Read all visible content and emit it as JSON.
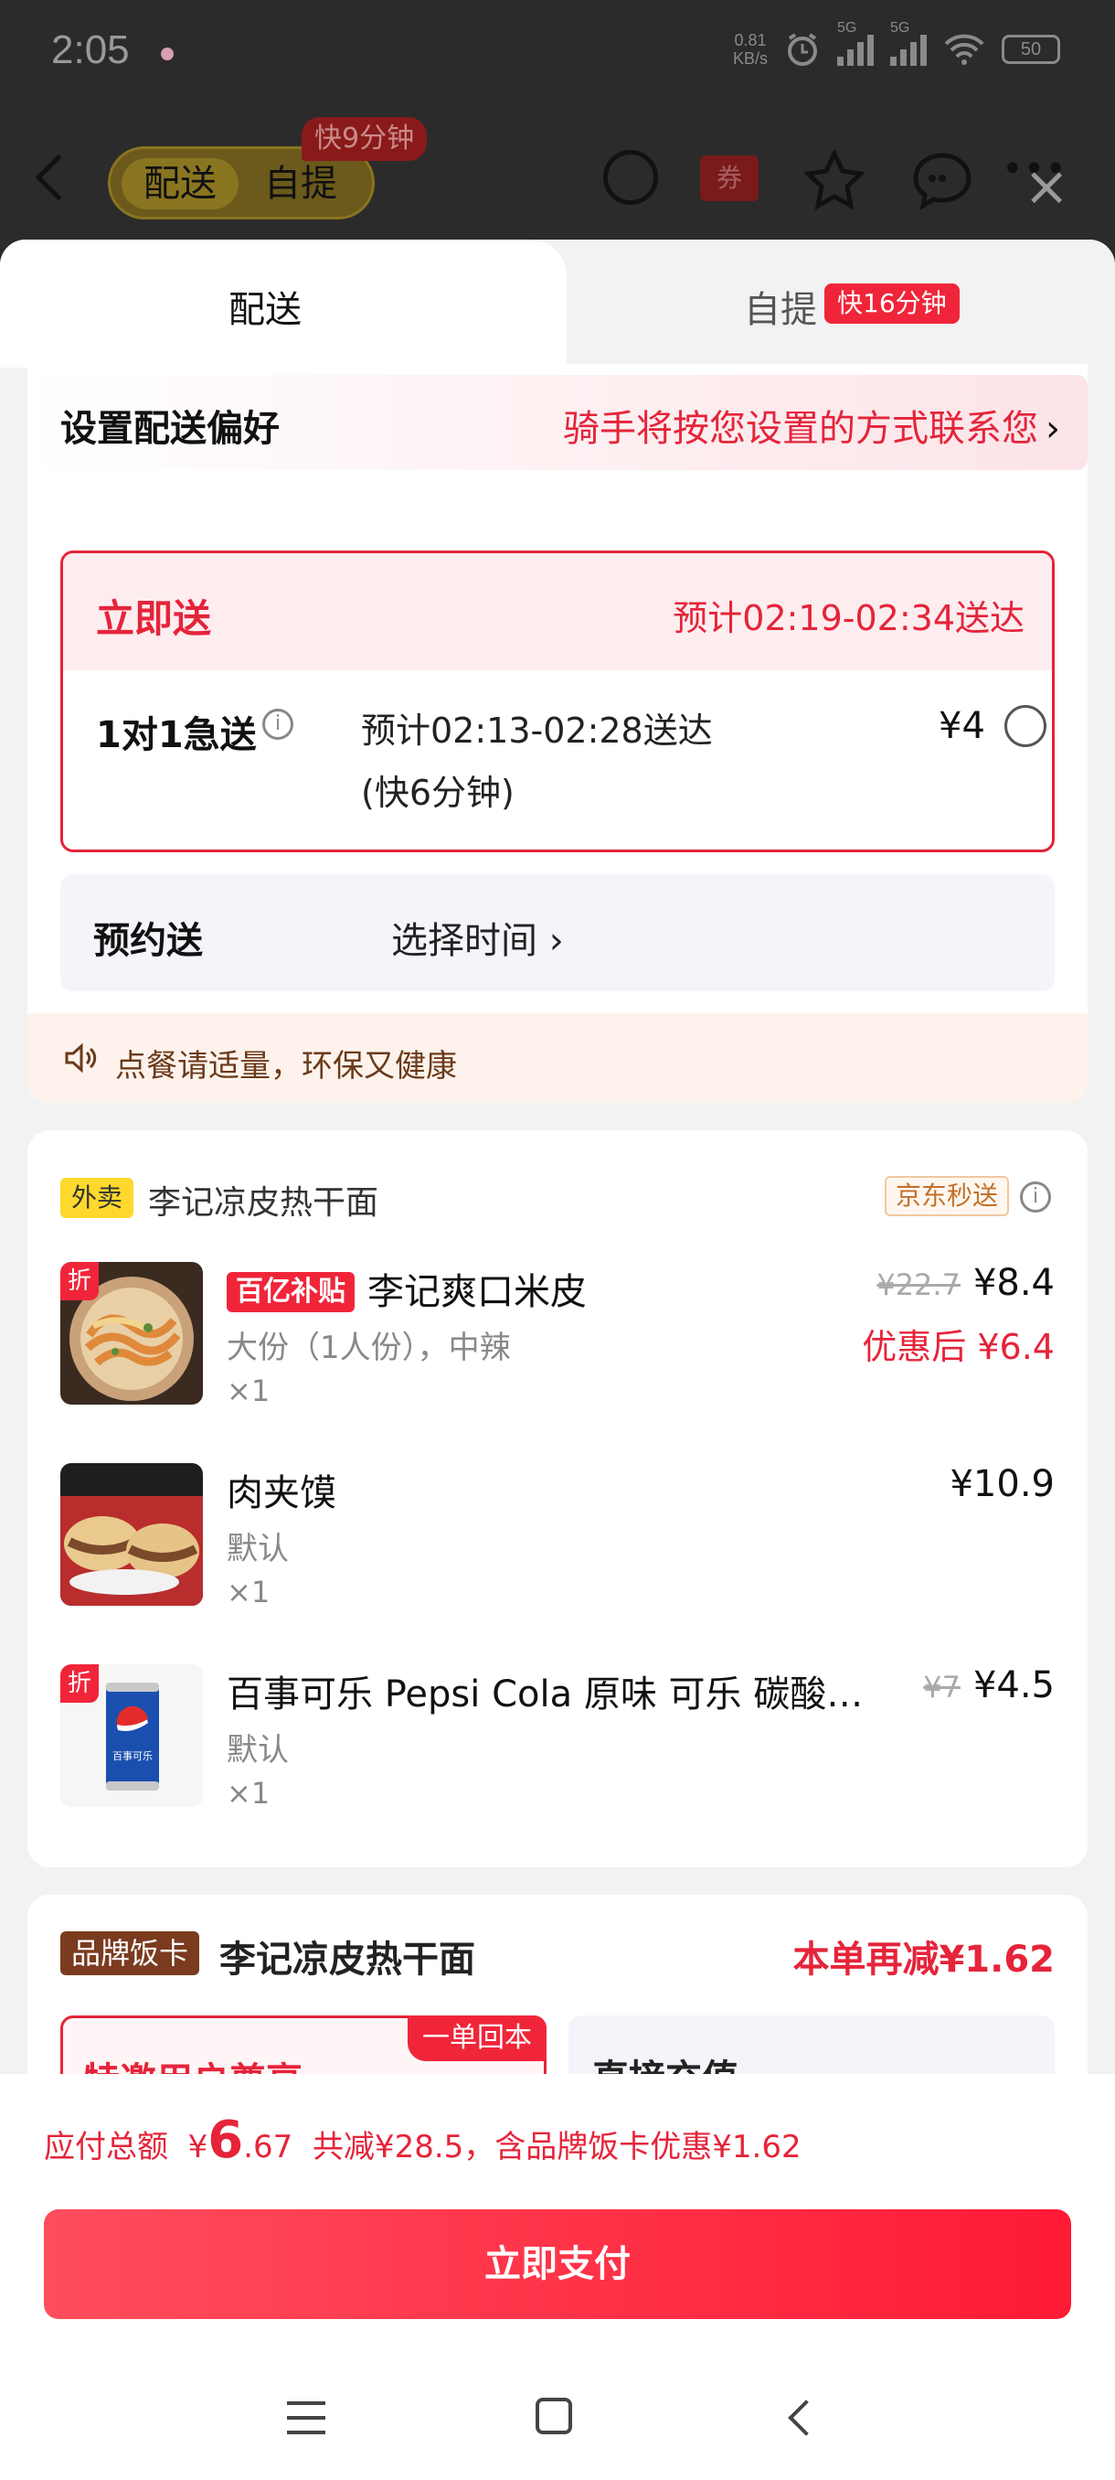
{
  "status_bar": {
    "time": "2:05",
    "net_speed": "0.81",
    "net_unit": "KB/s",
    "sim1": "5G",
    "sim2": "5G",
    "battery": "50"
  },
  "header": {
    "tabs": [
      "配送",
      "自提"
    ],
    "active_tab": "配送",
    "pickup_tag": "快9分钟",
    "coupon_label": "券",
    "more": "•••"
  },
  "sheet_tabs": {
    "delivery": "配送",
    "pickup": "自提",
    "pickup_badge": "快16分钟"
  },
  "preference": {
    "title": "设置配送偏好",
    "link": "骑手将按您设置的方式联系您",
    "chevron": "›"
  },
  "instant": {
    "title": "立即送",
    "eta": "预计02:19-02:34送达",
    "option_title": "1对1急送",
    "option_info": "i",
    "option_eta_line1": "预计02:13-02:28送达",
    "option_eta_line2": "(快6分钟)",
    "option_price": "¥4"
  },
  "scheduled": {
    "title": "预约送",
    "choose": "选择时间 ›"
  },
  "tip": "点餐请适量，环保又健康",
  "shop": {
    "type_badge": "外卖",
    "name": "李记凉皮热干面",
    "delivery_tag": "京东秒送",
    "info": "i"
  },
  "items": [
    {
      "discount_badge": "折",
      "subsidy": "百亿补贴",
      "name": "李记爽口米皮",
      "spec": "大份（1人份），中辣",
      "qty": "×1",
      "orig_price": "¥22.7",
      "price": "¥8.4",
      "after": "优惠后 ¥6.4"
    },
    {
      "name": "肉夹馍",
      "spec": "默认",
      "qty": "×1",
      "price": "¥10.9"
    },
    {
      "discount_badge": "折",
      "name": "百事可乐 Pepsi Cola 原味 可乐 碳酸…",
      "spec": "默认",
      "qty": "×1",
      "orig_price": "¥7",
      "price": "¥4.5",
      "can_label": "百事可乐"
    }
  ],
  "brand_card": {
    "tag": "品牌饭卡",
    "shop": "李记凉皮热干面",
    "saving": "本单再减¥1.62",
    "box1_title": "特邀用户尊享...",
    "box1_tag": "一单回本",
    "box2_title": "直接充值"
  },
  "footer": {
    "total_label": "应付总额",
    "currency": "¥",
    "total_int": "6",
    "total_dec": ".67",
    "discount": "共减¥28.5，含品牌饭卡优惠¥1.62",
    "pay_button": "立即支付"
  }
}
